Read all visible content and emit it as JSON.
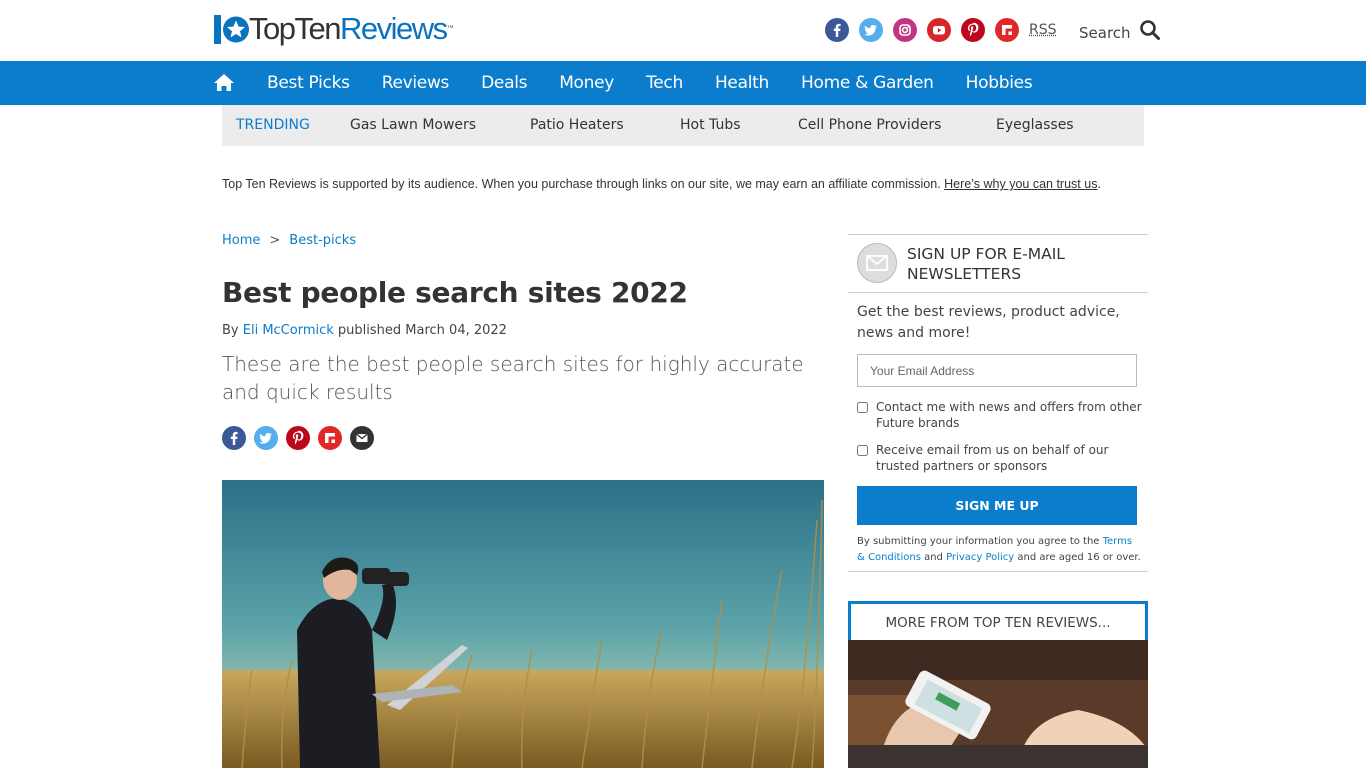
{
  "header": {
    "logo_number": "10",
    "logo_top_ten": "TopTen",
    "logo_reviews": "Reviews",
    "logo_tm": "™",
    "socials": [
      "facebook-icon",
      "twitter-icon",
      "instagram-icon",
      "youtube-icon",
      "pinterest-icon",
      "flipboard-icon"
    ],
    "rss_label": "RSS",
    "search_label": "Search"
  },
  "nav": {
    "items": [
      "Best Picks",
      "Reviews",
      "Deals",
      "Money",
      "Tech",
      "Health",
      "Home & Garden",
      "Hobbies"
    ]
  },
  "trending": {
    "label": "TRENDING",
    "items": [
      "Gas Lawn Mowers",
      "Patio Heaters",
      "Hot Tubs",
      "Cell Phone Providers",
      "Eyeglasses"
    ]
  },
  "affiliate": {
    "text": "Top Ten Reviews is supported by its audience. When you purchase through links on our site, we may earn an affiliate commission. ",
    "link": "Here’s why you can trust us",
    "end": "."
  },
  "breadcrumb": {
    "home": "Home",
    "sep": ">",
    "section": "Best-picks"
  },
  "article": {
    "title": "Best people search sites 2022",
    "by": "By ",
    "author": "Eli McCormick",
    "published": " published March 04, 2022",
    "strapline": "These are the best people search sites for highly accurate and quick results"
  },
  "share": [
    "facebook-icon",
    "twitter-icon",
    "pinterest-icon",
    "flipboard-icon",
    "email-icon"
  ],
  "newsletter": {
    "title": "SIGN UP FOR E-MAIL NEWSLETTERS",
    "description": "Get the best reviews, product advice, news and more!",
    "email_placeholder": "Your Email Address",
    "check1": "Contact me with news and offers from other Future brands",
    "check2": "Receive email from us on behalf of our trusted partners or sponsors",
    "button": "SIGN ME UP",
    "legal_1": "By submitting your information you agree to the ",
    "legal_terms": "Terms & Conditions",
    "legal_2": " and ",
    "legal_privacy": "Privacy Policy",
    "legal_3": " and are aged 16 or over."
  },
  "more": {
    "title": "MORE FROM TOP TEN REVIEWS..."
  },
  "colors": {
    "brand_blue": "#0b7dcc",
    "trending_bg": "#ececec"
  }
}
